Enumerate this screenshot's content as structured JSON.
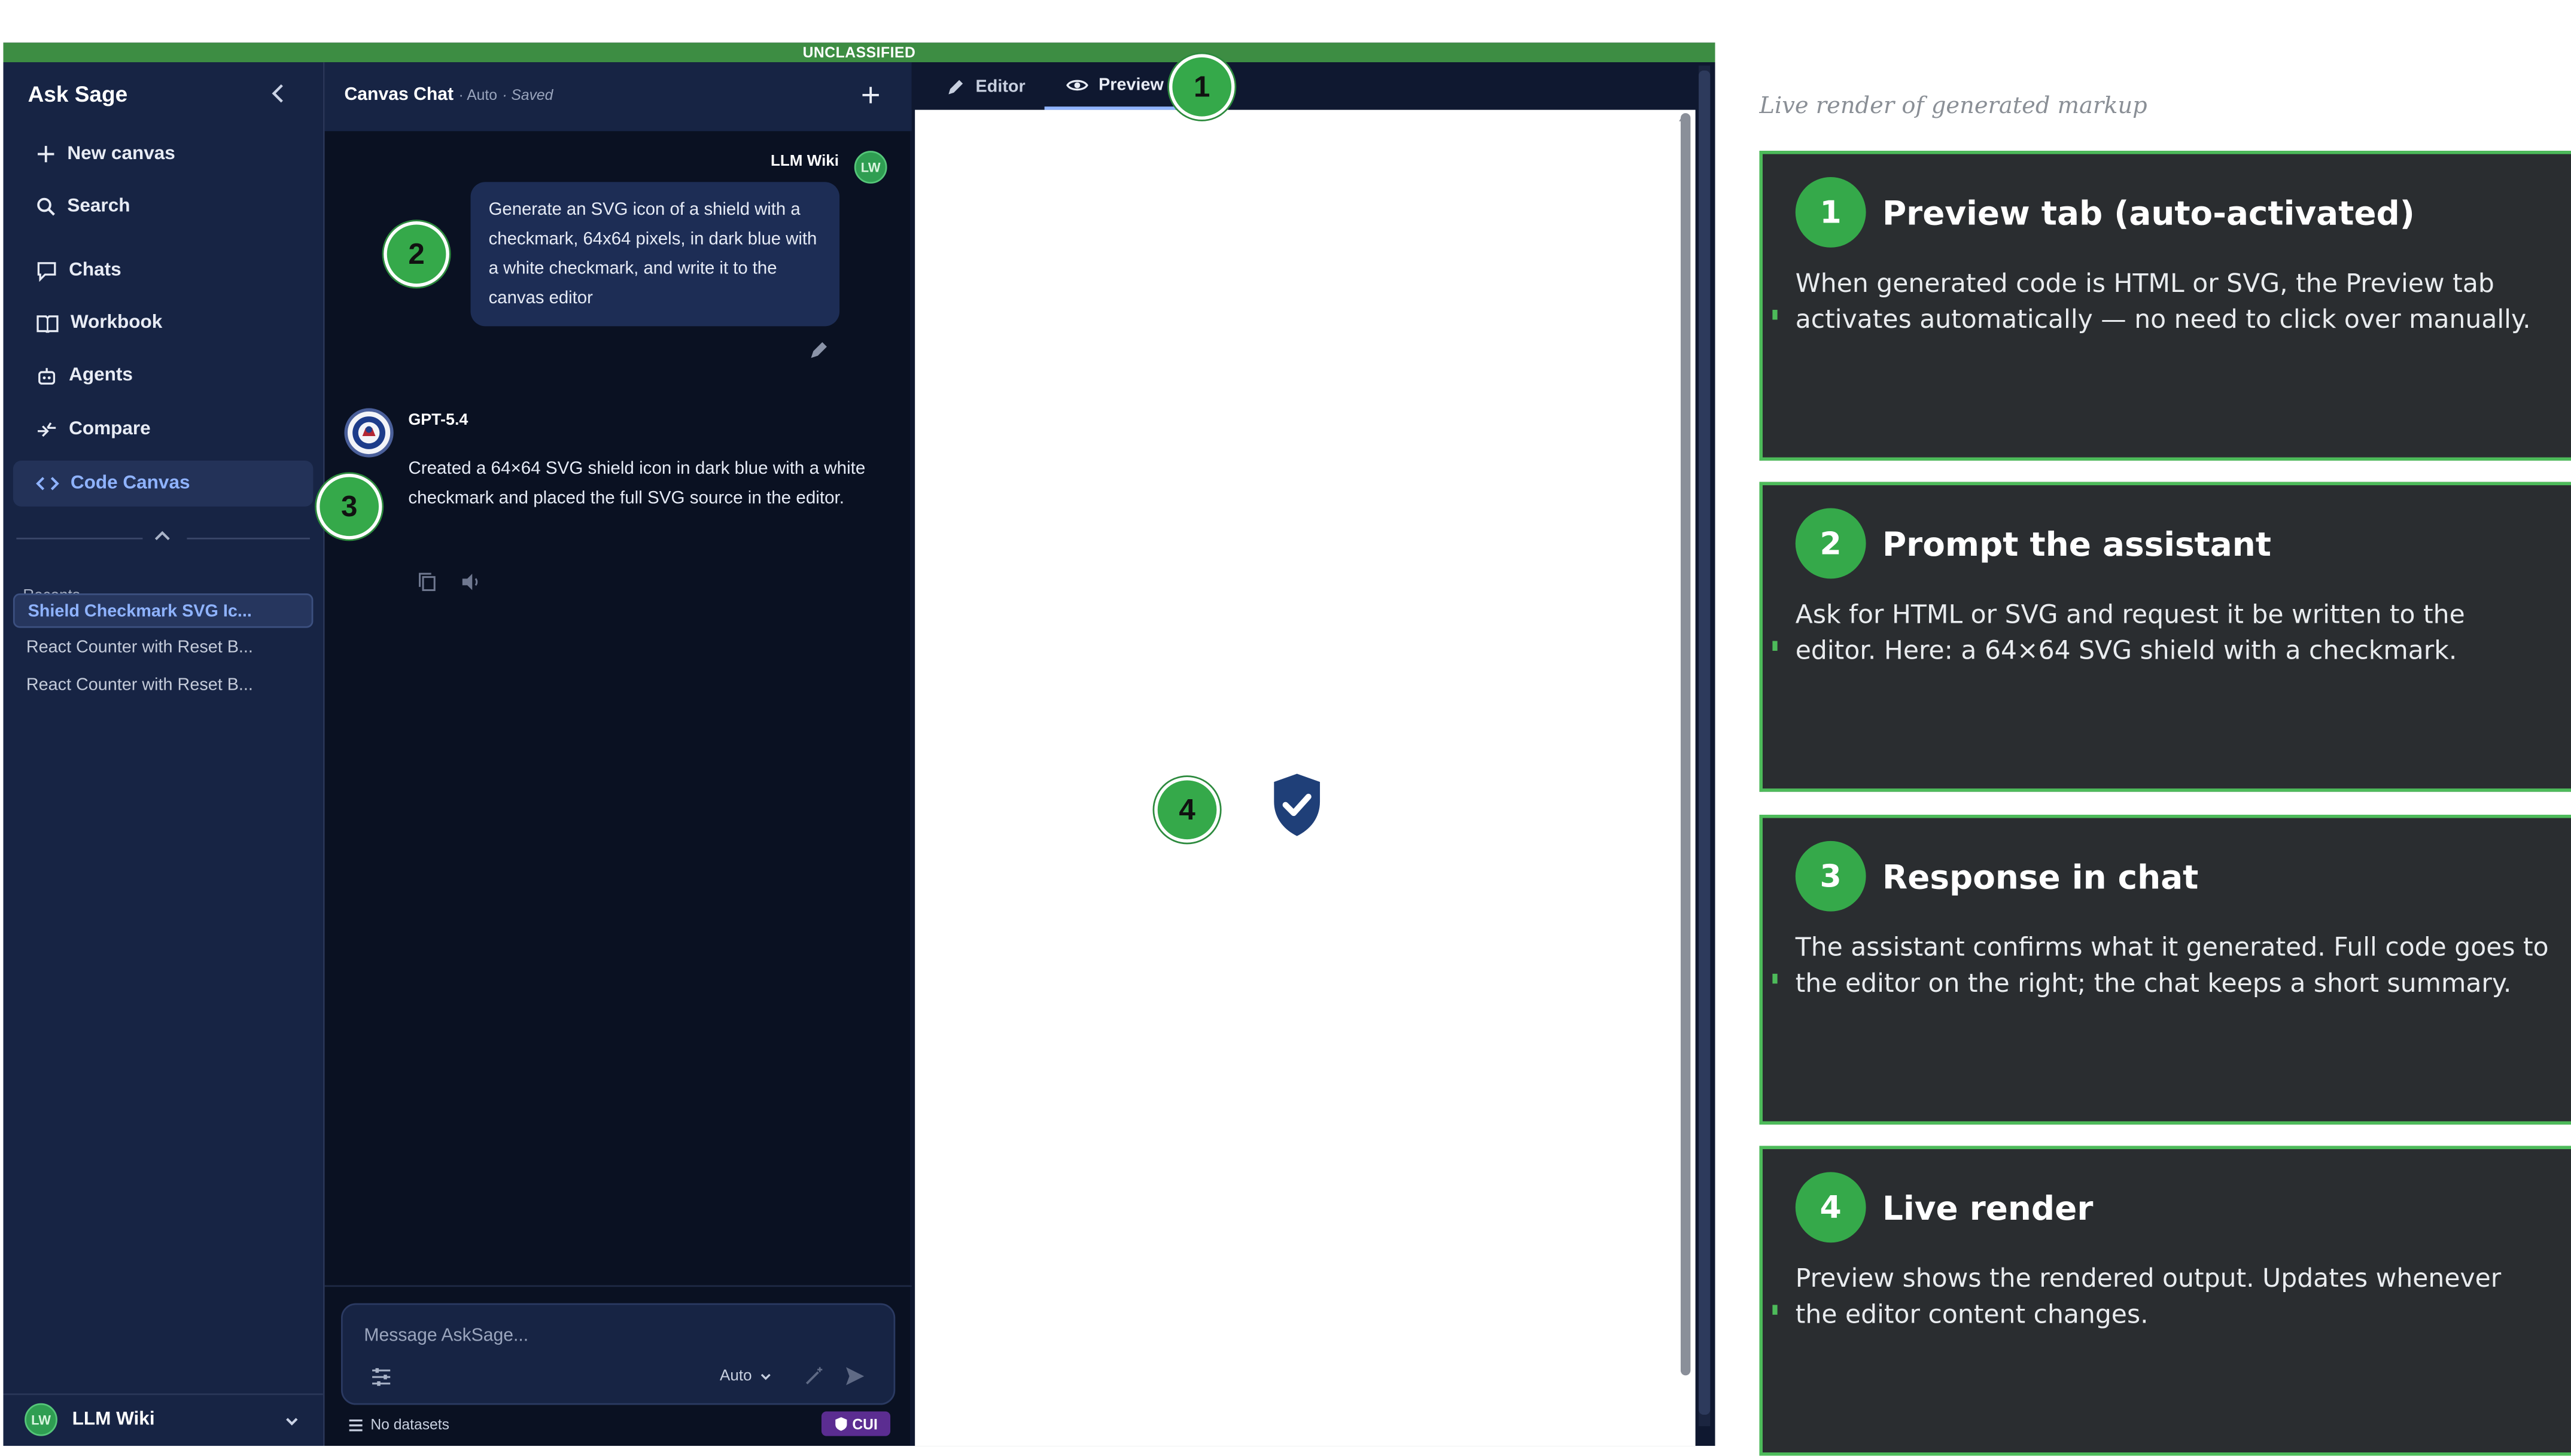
{
  "banner": "UNCLASSIFIED",
  "sidebar": {
    "brand": "Ask Sage",
    "items": [
      {
        "label": "New canvas",
        "icon": "plus-icon"
      },
      {
        "label": "Search",
        "icon": "search-icon"
      },
      {
        "label": "Chats",
        "icon": "chat-bubble-icon"
      },
      {
        "label": "Workbook",
        "icon": "book-icon"
      },
      {
        "label": "Agents",
        "icon": "robot-icon"
      },
      {
        "label": "Compare",
        "icon": "compare-icon"
      },
      {
        "label": "Code Canvas",
        "icon": "code-icon",
        "active": true
      }
    ],
    "recents_label": "Recents",
    "recents": [
      "Shield Checkmark SVG Ic...",
      "React Counter with Reset B...",
      "React Counter with Reset B..."
    ],
    "user": {
      "name": "LLM Wiki",
      "initials": "LW"
    }
  },
  "chat": {
    "title": "Canvas Chat",
    "mode": "· Auto",
    "status": "· Saved",
    "user_name": "LLM Wiki",
    "user_initials": "LW",
    "prompt": "Generate an SVG icon of a shield with a checkmark, 64x64 pixels, in dark blue with a white checkmark, and write it to the canvas editor",
    "model": "GPT-5.4",
    "response": "Created a 64×64 SVG shield icon in dark blue with a white checkmark and placed the full SVG source in the editor.",
    "composer": {
      "placeholder": "Message AskSage...",
      "model_select": "Auto"
    },
    "datasets": "No datasets",
    "cui": "CUI"
  },
  "tabs": {
    "editor": "Editor",
    "preview": "Preview"
  },
  "preview": {
    "shield_color": "#1f3f78",
    "check_color": "#ffffff"
  },
  "callouts": {
    "c1": "1",
    "c2": "2",
    "c3": "3",
    "c4": "4"
  },
  "annotations": {
    "caption": "Live render of generated markup",
    "cards": [
      {
        "num": "1",
        "title": "Preview tab (auto-activated)",
        "body": "When generated code is HTML or SVG, the Preview tab activates automatically — no need to click over manually."
      },
      {
        "num": "2",
        "title": "Prompt the assistant",
        "body": "Ask for HTML or SVG and request it be written to the editor. Here: a 64×64 SVG shield with a checkmark."
      },
      {
        "num": "3",
        "title": "Response in chat",
        "body": "The assistant confirms what it generated. Full code goes to the editor on the right; the chat keeps a short summary."
      },
      {
        "num": "4",
        "title": "Live render",
        "body": "Preview shows the rendered output. Updates whenever the editor content changes."
      }
    ]
  },
  "colors": {
    "accent_green": "#35a94a",
    "sidebar_bg": "#172444",
    "chat_bg": "#0a1122",
    "active_blue": "#8fb3ff",
    "cui_purple": "#5b2d91"
  }
}
